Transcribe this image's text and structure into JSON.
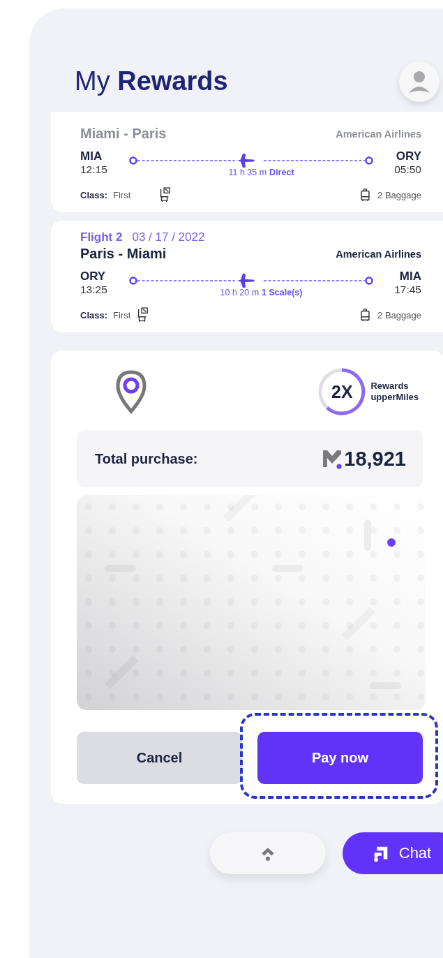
{
  "header": {
    "title": "My **Rewards**"
  },
  "flights": [
    {
      "faded": true,
      "route": "Miami - Paris",
      "airline": "American Airlines",
      "from": {
        "code": "MIA",
        "time": "12:15"
      },
      "to": {
        "code": "ORY",
        "time": "05:50"
      },
      "duration": "11 h 35 m",
      "stops": "Direct",
      "class_label": "Class:",
      "class_value": "First",
      "baggage": "2 Baggage"
    },
    {
      "faded": false,
      "label": "Flight 2",
      "date": "03 / 17 / 2022",
      "route": "Paris - Miami",
      "airline": "American Airlines",
      "from": {
        "code": "ORY",
        "time": "13:25"
      },
      "to": {
        "code": "MIA",
        "time": "17:45"
      },
      "duration": "10 h 20 m",
      "stops": "1 Scale(s)",
      "class_label": "Class:",
      "class_value": "First",
      "baggage": "2 Baggage"
    }
  ],
  "summary": {
    "multiplier": "2X",
    "rewards_line1": "Rewards",
    "rewards_line2": "upperMiles",
    "total_label": "Total purchase:",
    "total_amount": "18,921"
  },
  "buttons": [
    {
      "label": "Cancel",
      "kind": "secondary",
      "focused": false
    },
    {
      "label": "Pay now",
      "kind": "primary",
      "focused": true
    }
  ],
  "chat": {
    "label": "Chat"
  }
}
